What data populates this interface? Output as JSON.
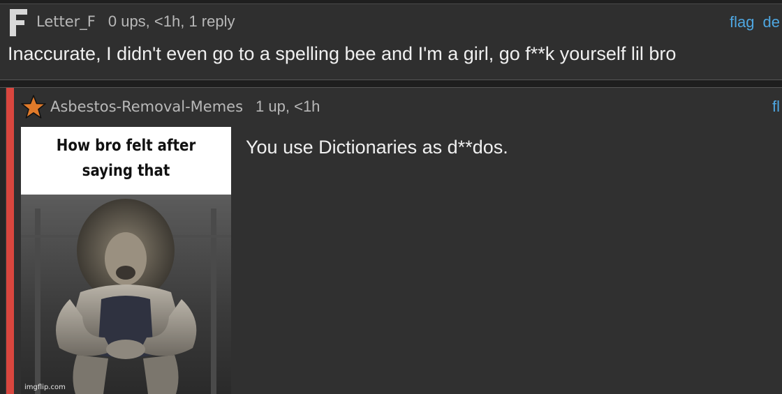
{
  "comment_parent": {
    "avatar_letter": "F",
    "username": "Letter_F",
    "stats": "0 ups, <1h, 1 reply",
    "actions": [
      "flag",
      "de"
    ],
    "text": "Inaccurate, I didn't even go to a spelling bee and I'm a girl, go f**k yourself lil bro"
  },
  "comment_reply": {
    "username": "Asbestos-Removal-Memes",
    "stats": "1 up, <1h",
    "actions": [
      "fl"
    ],
    "meme_caption_line1": "How bro felt after",
    "meme_caption_line2": "saying that",
    "watermark": "imgflip.com",
    "text": "You use Dictionaries as d**dos."
  },
  "colors": {
    "link": "#4ea6e0",
    "thread_bar": "#d9463e",
    "star": "#e07a2a",
    "background": "#2b2b2b"
  },
  "icons": {
    "parent_avatar": "letter-f-icon",
    "reply_badge": "star-icon"
  }
}
